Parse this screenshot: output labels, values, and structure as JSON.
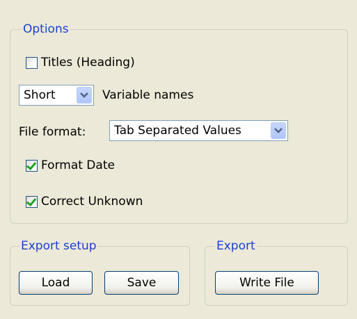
{
  "options": {
    "legend": "Options",
    "titles_checkbox": {
      "label": "Titles (Heading)",
      "checked": false
    },
    "variable_names": {
      "selected": "Short",
      "label": "Variable names"
    },
    "file_format": {
      "label": "File format:",
      "selected": "Tab Separated Values"
    },
    "format_date_checkbox": {
      "label": "Format Date",
      "checked": true
    },
    "correct_unknown_checkbox": {
      "label": "Correct Unknown",
      "checked": true
    }
  },
  "export_setup": {
    "legend": "Export setup",
    "load_label": "Load",
    "save_label": "Save"
  },
  "export": {
    "legend": "Export",
    "write_file_label": "Write File"
  },
  "icons": {
    "combo_arrow": "chevron-down-icon",
    "check": "checkmark-icon"
  },
  "colors": {
    "background": "#ece9d8",
    "legend_text": "#1a3fd6",
    "check_mark": "#21a121",
    "combo_arrow_bg": "#c6d6fb"
  }
}
